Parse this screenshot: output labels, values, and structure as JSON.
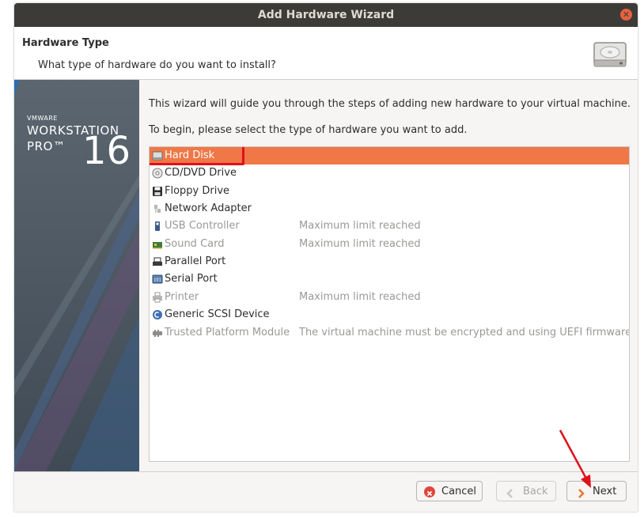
{
  "window": {
    "title": "Add Hardware Wizard"
  },
  "header": {
    "title": "Hardware Type",
    "subtitle": "What type of hardware do you want to install?"
  },
  "sidebar": {
    "brand_small": "VMWARE",
    "brand_name": "WORKSTATION",
    "brand_edition": "PRO™",
    "brand_version": "16"
  },
  "content": {
    "intro_line1": "This wizard will guide you through the steps of adding new hardware to your virtual machine.",
    "intro_line2": "To begin, please select the type of hardware you want to add."
  },
  "hardware_list": [
    {
      "name": "Hard Disk",
      "status": "",
      "icon": "hard-disk-icon",
      "selected": true,
      "disabled": false
    },
    {
      "name": "CD/DVD Drive",
      "status": "",
      "icon": "cd-dvd-icon",
      "selected": false,
      "disabled": false
    },
    {
      "name": "Floppy Drive",
      "status": "",
      "icon": "floppy-icon",
      "selected": false,
      "disabled": false
    },
    {
      "name": "Network Adapter",
      "status": "",
      "icon": "network-icon",
      "selected": false,
      "disabled": false
    },
    {
      "name": "USB Controller",
      "status": "Maximum limit reached",
      "icon": "usb-icon",
      "selected": false,
      "disabled": true
    },
    {
      "name": "Sound Card",
      "status": "Maximum limit reached",
      "icon": "sound-card-icon",
      "selected": false,
      "disabled": true
    },
    {
      "name": "Parallel Port",
      "status": "",
      "icon": "parallel-port-icon",
      "selected": false,
      "disabled": false
    },
    {
      "name": "Serial Port",
      "status": "",
      "icon": "serial-port-icon",
      "selected": false,
      "disabled": false
    },
    {
      "name": "Printer",
      "status": "Maximum limit reached",
      "icon": "printer-icon",
      "selected": false,
      "disabled": true
    },
    {
      "name": "Generic SCSI Device",
      "status": "",
      "icon": "scsi-icon",
      "selected": false,
      "disabled": false
    },
    {
      "name": "Trusted Platform Module",
      "status": "The virtual machine must be encrypted and using UEFI firmware.",
      "icon": "tpm-icon",
      "selected": false,
      "disabled": true
    }
  ],
  "buttons": {
    "cancel": "Cancel",
    "back": "Back",
    "next": "Next"
  },
  "colors": {
    "selection": "#f07746",
    "annotation_red": "#e0101a",
    "titlebar": "#3c3b37"
  }
}
